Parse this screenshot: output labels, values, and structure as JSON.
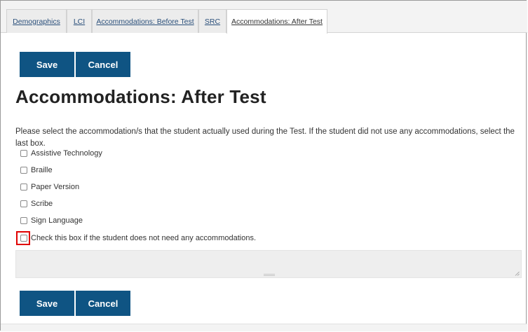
{
  "tabs": [
    {
      "label": "Demographics",
      "active": false
    },
    {
      "label": "LCI",
      "active": false
    },
    {
      "label": "Accommodations: Before Test",
      "active": false
    },
    {
      "label": "SRC",
      "active": false
    },
    {
      "label": "Accommodations: After Test",
      "active": true
    }
  ],
  "toolbar": {
    "save_label": "Save",
    "cancel_label": "Cancel"
  },
  "page": {
    "title": "Accommodations: After Test",
    "instructions": "Please select the accommodation/s that the student actually used during the Test. If the student did not use any accommodations, select the last box."
  },
  "accommodations": [
    {
      "label": "Assistive Technology",
      "checked": false
    },
    {
      "label": "Braille",
      "checked": false
    },
    {
      "label": "Paper Version",
      "checked": false
    },
    {
      "label": "Scribe",
      "checked": false
    },
    {
      "label": "Sign Language",
      "checked": false
    },
    {
      "label": "Check this box if the student does not need any accommodations.",
      "checked": false
    }
  ],
  "notes": {
    "value": ""
  },
  "colors": {
    "button": "#0f5483",
    "highlight": "#e00000",
    "tab_link": "#2a4f7a"
  }
}
